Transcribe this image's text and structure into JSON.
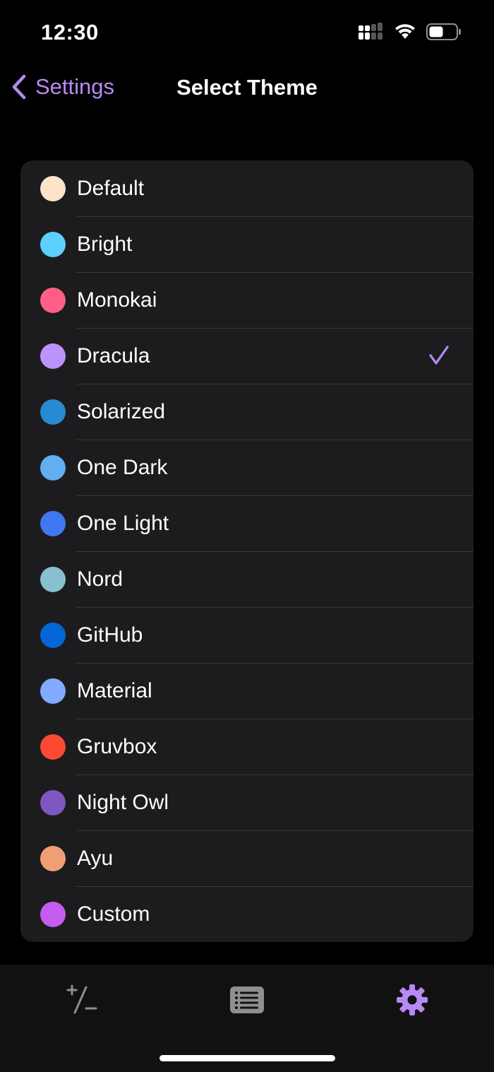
{
  "status_bar": {
    "time": "12:30"
  },
  "nav": {
    "back_label": "Settings",
    "title": "Select Theme"
  },
  "accent_color": "#b889f5",
  "themes": [
    {
      "label": "Default",
      "color": "#ffe3c9",
      "selected": false
    },
    {
      "label": "Bright",
      "color": "#5ed0ff",
      "selected": false
    },
    {
      "label": "Monokai",
      "color": "#ff5f87",
      "selected": false
    },
    {
      "label": "Dracula",
      "color": "#bd93f9",
      "selected": true
    },
    {
      "label": "Solarized",
      "color": "#268bd2",
      "selected": false
    },
    {
      "label": "One Dark",
      "color": "#61afef",
      "selected": false
    },
    {
      "label": "One Light",
      "color": "#4078f2",
      "selected": false
    },
    {
      "label": "Nord",
      "color": "#88c0d0",
      "selected": false
    },
    {
      "label": "GitHub",
      "color": "#0366d6",
      "selected": false
    },
    {
      "label": "Material",
      "color": "#82aaff",
      "selected": false
    },
    {
      "label": "Gruvbox",
      "color": "#fb4934",
      "selected": false
    },
    {
      "label": "Night Owl",
      "color": "#7e57c2",
      "selected": false
    },
    {
      "label": "Ayu",
      "color": "#f29e74",
      "selected": false
    },
    {
      "label": "Custom",
      "color": "#c45cf0",
      "selected": false
    }
  ],
  "tab_bar": {
    "tabs": [
      {
        "icon": "plus-minus-icon",
        "active": false
      },
      {
        "icon": "list-icon",
        "active": false
      },
      {
        "icon": "gear-icon",
        "active": true
      }
    ]
  }
}
